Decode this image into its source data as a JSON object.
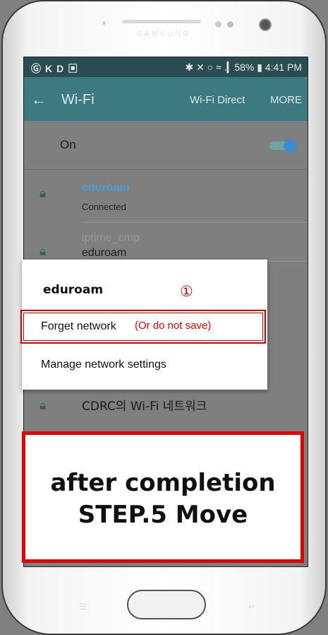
{
  "device": {
    "brand": "SAMSUNG"
  },
  "status_bar": {
    "left_icons": "ⒼKD▣",
    "right_text": "✱ ✕ ○ ≈ .▎58% ▮ 4:41 PM"
  },
  "toolbar": {
    "back_label": "←",
    "title": "Wi-Fi",
    "wifi_direct": "Wi-Fi Direct",
    "more": "MORE"
  },
  "wifi_toggle": {
    "label": "On",
    "state": "on"
  },
  "networks": [
    {
      "name": "eduroam",
      "status": "Connected",
      "color": "#4a9fd6"
    },
    {
      "name": "iptime_cmp",
      "status": ""
    },
    {
      "name": "eduroam",
      "status": ""
    },
    {
      "name": "CDRC의 Wi-Fi 네트워크",
      "status": ""
    }
  ],
  "dialog": {
    "title": "eduroam",
    "step_marker": "①",
    "forget_label": "Forget network",
    "forget_note": "(Or do not save)",
    "manage_label": "Manage network settings"
  },
  "banner": {
    "line1": "after completion",
    "line2": "STEP.5 Move"
  },
  "colors": {
    "accent": "#3d7a80",
    "highlight": "#e00000"
  }
}
